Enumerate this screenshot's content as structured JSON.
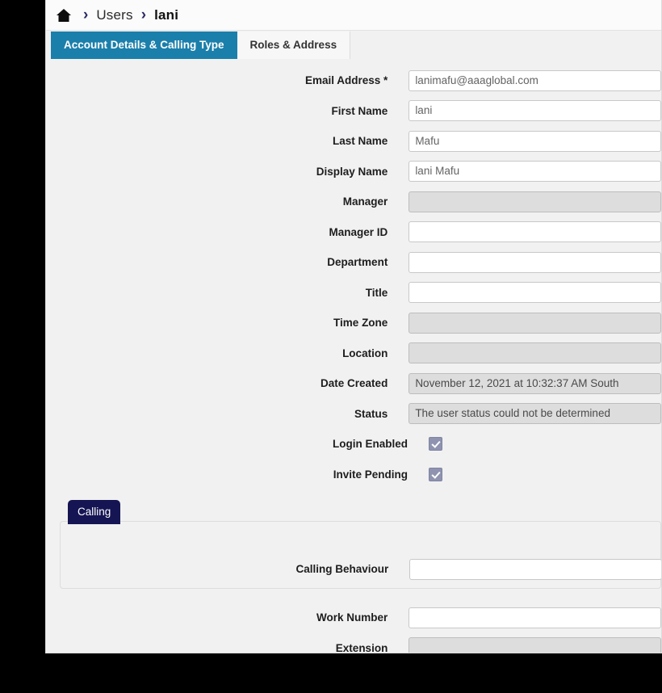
{
  "breadcrumb": {
    "home_icon": "home-icon",
    "separator": "›",
    "items": [
      {
        "label": "Users"
      },
      {
        "label": "lani"
      }
    ]
  },
  "tabs": [
    {
      "label": "Account Details & Calling Type",
      "active": true
    },
    {
      "label": "Roles & Address",
      "active": false
    }
  ],
  "colors": {
    "active_tab": "#1b7fab",
    "calling_legend": "#151554",
    "checkbox": "#8f93b0",
    "page_background": "#f1f1f1"
  },
  "account_details": {
    "fields": [
      {
        "label": "Email Address *",
        "value": "lanimafu@aaaglobal.com",
        "disabled": false
      },
      {
        "label": "First Name",
        "value": "lani",
        "disabled": false
      },
      {
        "label": "Last Name",
        "value": "Mafu",
        "disabled": false
      },
      {
        "label": "Display Name",
        "value": "lani Mafu",
        "disabled": false
      },
      {
        "label": "Manager",
        "value": "",
        "disabled": true
      },
      {
        "label": "Manager ID",
        "value": "",
        "disabled": false
      },
      {
        "label": "Department",
        "value": "",
        "disabled": false
      },
      {
        "label": "Title",
        "value": "",
        "disabled": false
      },
      {
        "label": "Time Zone",
        "value": "",
        "disabled": true
      },
      {
        "label": "Location",
        "value": "",
        "disabled": true
      },
      {
        "label": "Date Created",
        "value": "November 12, 2021 at 10:32:37 AM South",
        "disabled": true
      },
      {
        "label": "Status",
        "value": "The user status could not be determined",
        "disabled": true
      }
    ],
    "checkboxes": [
      {
        "label": "Login Enabled",
        "checked": true
      },
      {
        "label": "Invite Pending",
        "checked": true
      }
    ]
  },
  "calling_section": {
    "legend": "Calling",
    "fields": [
      {
        "label": "Calling Behaviour",
        "value": "",
        "disabled": false
      }
    ]
  },
  "bottom_fields": [
    {
      "label": "Work Number",
      "value": "",
      "disabled": false
    },
    {
      "label": "Extension",
      "value": "",
      "disabled": true
    }
  ]
}
